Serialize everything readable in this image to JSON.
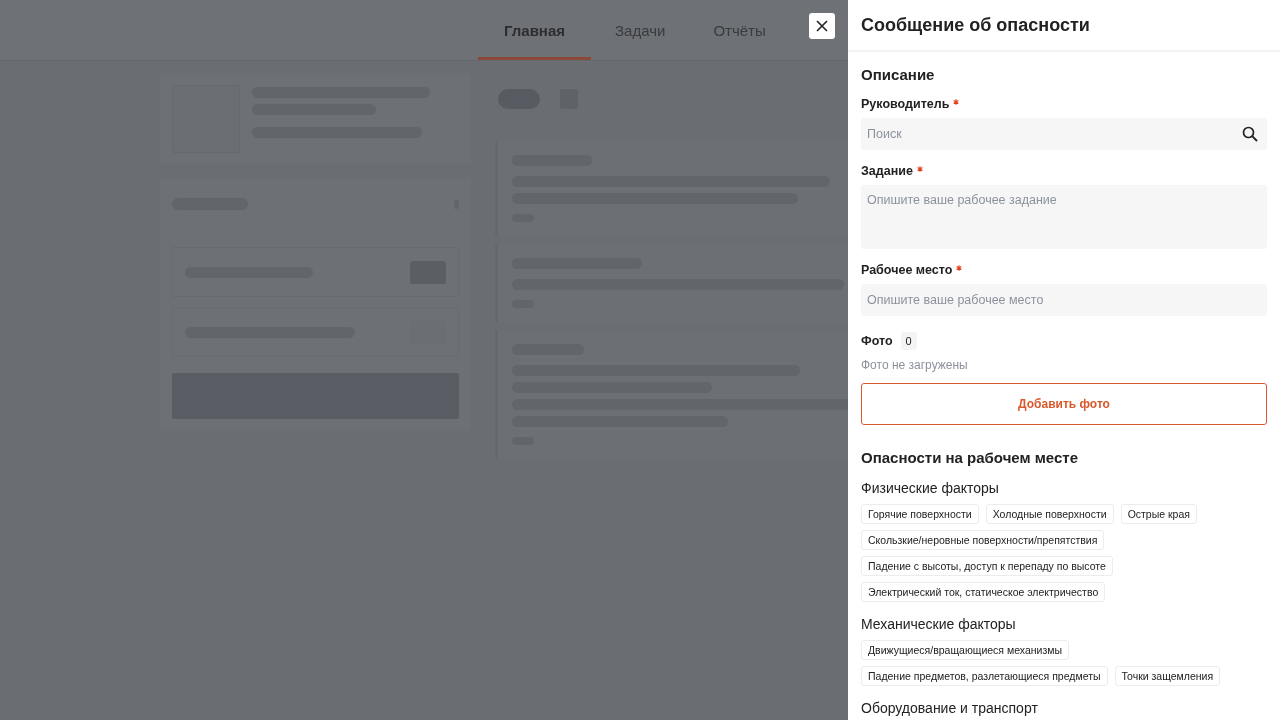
{
  "tabs": [
    {
      "label": "Главная",
      "selected": true
    },
    {
      "label": "Задачи",
      "selected": false
    },
    {
      "label": "Отчёты",
      "selected": false
    }
  ],
  "drawer": {
    "title": "Сообщение об опасности",
    "section_title": "Описание",
    "fields": [
      {
        "kind": "search",
        "label": "Руководитель",
        "required": true,
        "placeholder": "Поиск"
      },
      {
        "kind": "textarea",
        "label": "Задание",
        "required": true,
        "placeholder": "Опишите ваше рабочее задание"
      },
      {
        "kind": "text",
        "label": "Рабочее место",
        "required": true,
        "placeholder": "Опишите ваше рабочее место"
      }
    ],
    "photo": {
      "label": "Фото",
      "count": "0",
      "empty_text": "Фото не загружены",
      "button": "Добавить фото"
    },
    "hazards": {
      "title": "Опасности на рабочем месте",
      "groups": [
        {
          "title": "Физические факторы",
          "chips": [
            {
              "label": "Горячие поверхности",
              "selected": false
            },
            {
              "label": "Холодные поверхности",
              "selected": false
            },
            {
              "label": "Острые края",
              "selected": false
            },
            {
              "label": "Скользкие/неровные поверхности/препятствия",
              "selected": false
            },
            {
              "label": "Падение с высоты, доступ к перепаду по высоте",
              "selected": false
            },
            {
              "label": "Электрический ток, статическое электричество",
              "selected": false
            }
          ]
        },
        {
          "title": "Механические факторы",
          "chips": [
            {
              "label": "Движущиеся/вращающиеся механизмы",
              "selected": false
            },
            {
              "label": "Падение предметов, разлетающиеся предметы",
              "selected": false
            },
            {
              "label": "Точки защемления",
              "selected": false
            }
          ]
        },
        {
          "title": "Оборудование и транспорт"
        }
      ]
    }
  }
}
